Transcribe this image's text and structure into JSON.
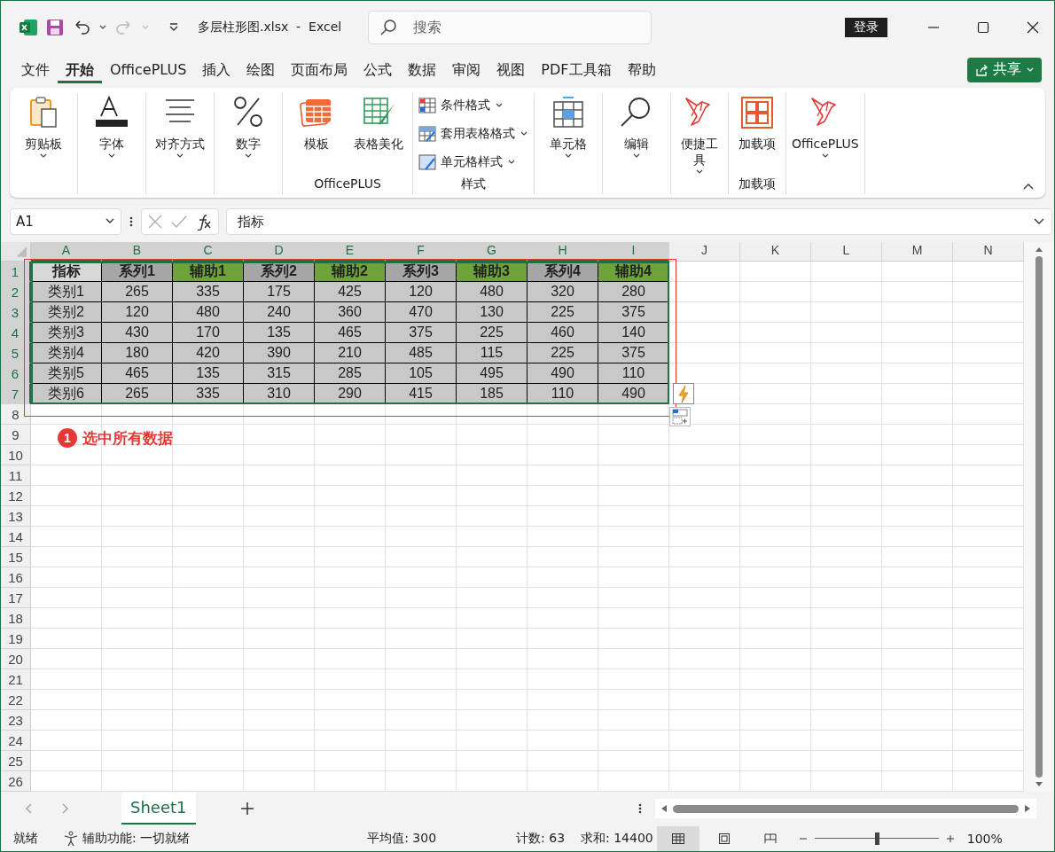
{
  "window": {
    "title": "多层柱形图.xlsx  -  Excel"
  },
  "search": {
    "placeholder": "搜索"
  },
  "sign_in": "登录",
  "menu_tabs": [
    {
      "label": "文件",
      "selected": false
    },
    {
      "label": "开始",
      "selected": true
    },
    {
      "label": "OfficePLUS",
      "selected": false
    },
    {
      "label": "插入",
      "selected": false
    },
    {
      "label": "绘图",
      "selected": false
    },
    {
      "label": "页面布局",
      "selected": false
    },
    {
      "label": "公式",
      "selected": false
    },
    {
      "label": "数据",
      "selected": false
    },
    {
      "label": "审阅",
      "selected": false
    },
    {
      "label": "视图",
      "selected": false
    },
    {
      "label": "PDF工具箱",
      "selected": false
    },
    {
      "label": "帮助",
      "selected": false
    }
  ],
  "share": "共享",
  "ribbon_groups": [
    {
      "items": [
        {
          "kind": "large",
          "label": "剪贴板",
          "dropdown": true
        }
      ]
    },
    {
      "items": [
        {
          "kind": "large",
          "label": "字体",
          "dropdown": true
        }
      ]
    },
    {
      "items": [
        {
          "kind": "large",
          "label": "对齐方式",
          "dropdown": true
        }
      ]
    },
    {
      "items": [
        {
          "kind": "large",
          "label": "数字",
          "dropdown": true
        }
      ]
    },
    {
      "label": "OfficePLUS",
      "items": [
        {
          "kind": "large",
          "label": "模板",
          "dropdown": false
        },
        {
          "kind": "large",
          "label": "表格美化",
          "dropdown": false
        }
      ]
    },
    {
      "label": "样式",
      "items": [
        {
          "kind": "small",
          "label": "条件格式",
          "dropdown": true
        },
        {
          "kind": "small",
          "label": "套用表格格式",
          "dropdown": true
        },
        {
          "kind": "small",
          "label": "单元格样式",
          "dropdown": true
        }
      ]
    },
    {
      "items": [
        {
          "kind": "large",
          "label": "单元格",
          "dropdown": true
        }
      ]
    },
    {
      "items": [
        {
          "kind": "large",
          "label": "编辑",
          "dropdown": true
        }
      ]
    },
    {
      "items": [
        {
          "kind": "large",
          "label": "便捷工具",
          "dropdown": true
        }
      ]
    },
    {
      "label": "加载项",
      "items": [
        {
          "kind": "large",
          "label": "加载项",
          "dropdown": false
        }
      ]
    },
    {
      "items": [
        {
          "kind": "large",
          "label": "OfficePLUS",
          "dropdown": true
        }
      ]
    }
  ],
  "formula_bar": {
    "name_box": "A1",
    "formula": "指标"
  },
  "columns": [
    {
      "label": "A",
      "selected": true
    },
    {
      "label": "B",
      "selected": true
    },
    {
      "label": "C",
      "selected": true
    },
    {
      "label": "D",
      "selected": true
    },
    {
      "label": "E",
      "selected": true
    },
    {
      "label": "F",
      "selected": true
    },
    {
      "label": "G",
      "selected": true
    },
    {
      "label": "H",
      "selected": true
    },
    {
      "label": "I",
      "selected": true
    },
    {
      "label": "J",
      "selected": false
    },
    {
      "label": "K",
      "selected": false
    },
    {
      "label": "L",
      "selected": false
    },
    {
      "label": "M",
      "selected": false
    },
    {
      "label": "N",
      "selected": false
    }
  ],
  "row_numbers": [
    {
      "label": "1",
      "selected": true
    },
    {
      "label": "2",
      "selected": true
    },
    {
      "label": "3",
      "selected": true
    },
    {
      "label": "4",
      "selected": true
    },
    {
      "label": "5",
      "selected": true
    },
    {
      "label": "6",
      "selected": true
    },
    {
      "label": "7",
      "selected": true
    },
    {
      "label": "8",
      "selected": false
    },
    {
      "label": "9",
      "selected": false
    },
    {
      "label": "10",
      "selected": false
    },
    {
      "label": "11",
      "selected": false
    },
    {
      "label": "12",
      "selected": false
    },
    {
      "label": "13",
      "selected": false
    },
    {
      "label": "14",
      "selected": false
    },
    {
      "label": "15",
      "selected": false
    },
    {
      "label": "16",
      "selected": false
    },
    {
      "label": "17",
      "selected": false
    },
    {
      "label": "18",
      "selected": false
    },
    {
      "label": "19",
      "selected": false
    },
    {
      "label": "20",
      "selected": false
    },
    {
      "label": "21",
      "selected": false
    },
    {
      "label": "22",
      "selected": false
    },
    {
      "label": "23",
      "selected": false
    },
    {
      "label": "24",
      "selected": false
    },
    {
      "label": "25",
      "selected": false
    },
    {
      "label": "26",
      "selected": false
    }
  ],
  "table": {
    "header": [
      {
        "text": "指标",
        "kind": "label"
      },
      {
        "text": "系列1",
        "kind": "series"
      },
      {
        "text": "辅助1",
        "kind": "aux"
      },
      {
        "text": "系列2",
        "kind": "series"
      },
      {
        "text": "辅助2",
        "kind": "aux"
      },
      {
        "text": "系列3",
        "kind": "series"
      },
      {
        "text": "辅助3",
        "kind": "aux"
      },
      {
        "text": "系列4",
        "kind": "series"
      },
      {
        "text": "辅助4",
        "kind": "aux"
      }
    ],
    "rows": [
      [
        "类别1",
        "265",
        "335",
        "175",
        "425",
        "120",
        "480",
        "320",
        "280"
      ],
      [
        "类别2",
        "120",
        "480",
        "240",
        "360",
        "470",
        "130",
        "225",
        "375"
      ],
      [
        "类别3",
        "430",
        "170",
        "135",
        "465",
        "375",
        "225",
        "460",
        "140"
      ],
      [
        "类别4",
        "180",
        "420",
        "390",
        "210",
        "485",
        "115",
        "225",
        "375"
      ],
      [
        "类别5",
        "465",
        "135",
        "315",
        "285",
        "105",
        "495",
        "490",
        "110"
      ],
      [
        "类别6",
        "265",
        "335",
        "310",
        "290",
        "415",
        "185",
        "110",
        "490"
      ]
    ]
  },
  "annotation": {
    "badge": "1",
    "text": "选中所有数据"
  },
  "sheet_tabs": [
    {
      "label": "Sheet1",
      "selected": true
    }
  ],
  "status_bar": {
    "ready": "就绪",
    "accessibility": "辅助功能: 一切就绪",
    "average": "平均值: 300",
    "count": "计数: 63",
    "sum": "求和: 14400",
    "view_modes": [
      {
        "kind": "normal",
        "selected": true
      },
      {
        "kind": "page-layout",
        "selected": false
      },
      {
        "kind": "page-break",
        "selected": false
      }
    ],
    "zoom": {
      "level": 0.5,
      "reading": "100%"
    }
  }
}
